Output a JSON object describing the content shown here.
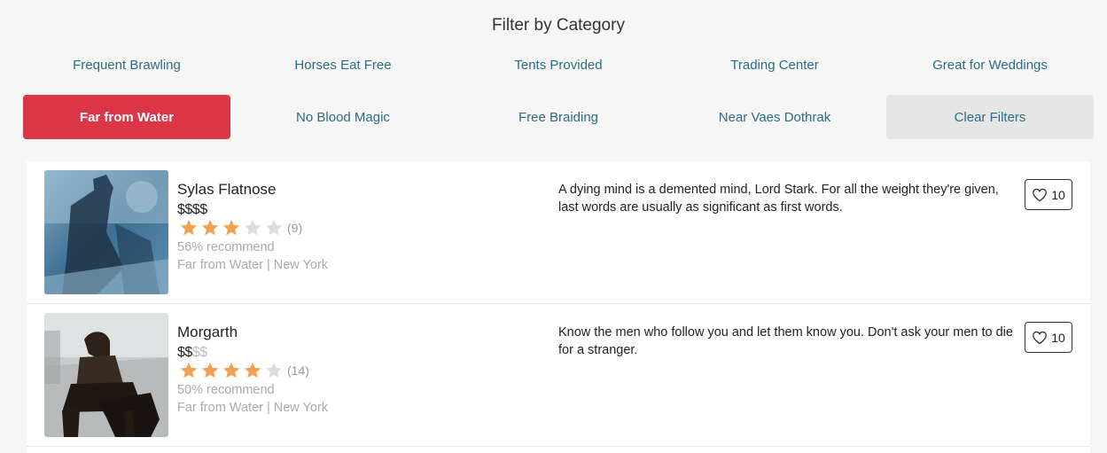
{
  "filters": {
    "title": "Filter by Category",
    "row1": [
      "Frequent Brawling",
      "Horses Eat Free",
      "Tents Provided",
      "Trading Center",
      "Great for Weddings"
    ],
    "row2": [
      "Far from Water",
      "No Blood Magic",
      "Free Braiding",
      "Near Vaes Dothrak"
    ],
    "active": "Far from Water",
    "clear_label": "Clear Filters"
  },
  "colors": {
    "accent_red": "#dc3545",
    "link_teal": "#2a6c82",
    "star_orange": "#f5a050"
  },
  "listings": [
    {
      "name": "Sylas Flatnose",
      "price_active": "$$$$",
      "price_inactive": "",
      "rating": 3,
      "reviews": "(9)",
      "recommend": "56% recommend",
      "location": "Far from Water | New York",
      "quote": "A dying mind is a demented mind, Lord Stark. For all the weight they're given, last words are usually as significant as first words.",
      "likes": "10",
      "image_icon": "snow-rider-photo"
    },
    {
      "name": "Morgarth",
      "price_active": "$$",
      "price_inactive": "$$",
      "rating": 4,
      "reviews": "(14)",
      "recommend": "50% recommend",
      "location": "Far from Water | New York",
      "quote": "Know the men who follow you and let them know you. Don't ask your men to die for a stranger.",
      "likes": "10",
      "image_icon": "horseback-rider-photo"
    }
  ]
}
